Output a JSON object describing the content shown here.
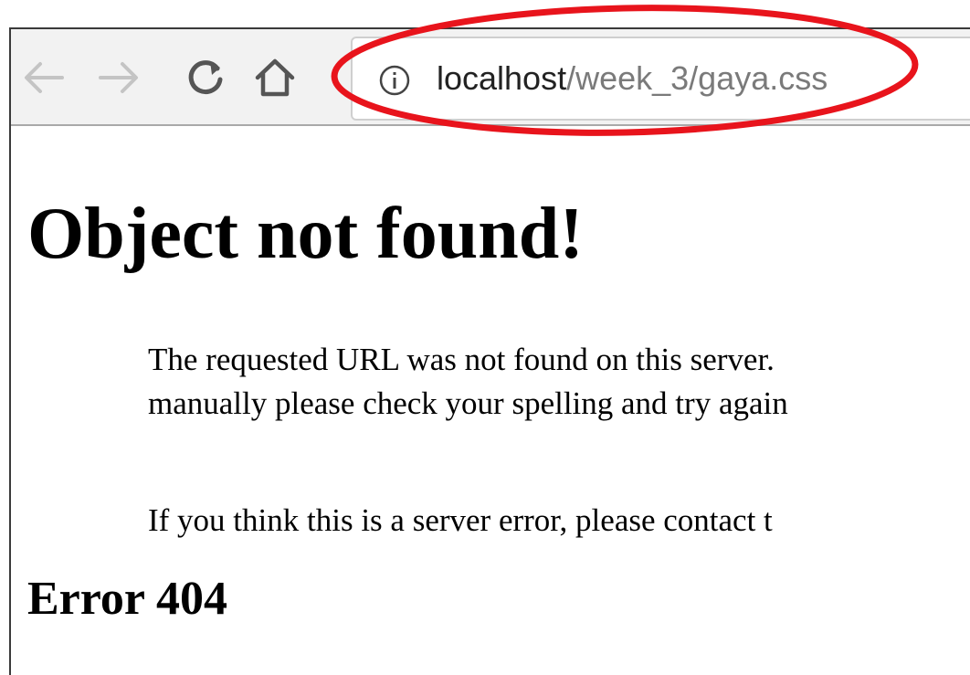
{
  "toolbar": {
    "back_label": "←",
    "forward_label": "→",
    "reload_label": "C",
    "home_label": "⌂",
    "info_icon": "info-circle-icon",
    "url_host": "localhost",
    "url_path": "/week_3/gaya.css"
  },
  "annotation": {
    "color": "#e8141c",
    "shape": "ellipse"
  },
  "page": {
    "title": "Object not found!",
    "paragraph1_line1": "The requested URL was not found on this server.",
    "paragraph1_line2": "manually please check your spelling and try again",
    "paragraph2": "If you think this is a server error, please contact t",
    "error_heading": "Error 404"
  },
  "colors": {
    "toolbar_bg": "#f2f2f2",
    "nav_icon": "#9a9a9a",
    "reload_icon": "#5a5a5a"
  }
}
